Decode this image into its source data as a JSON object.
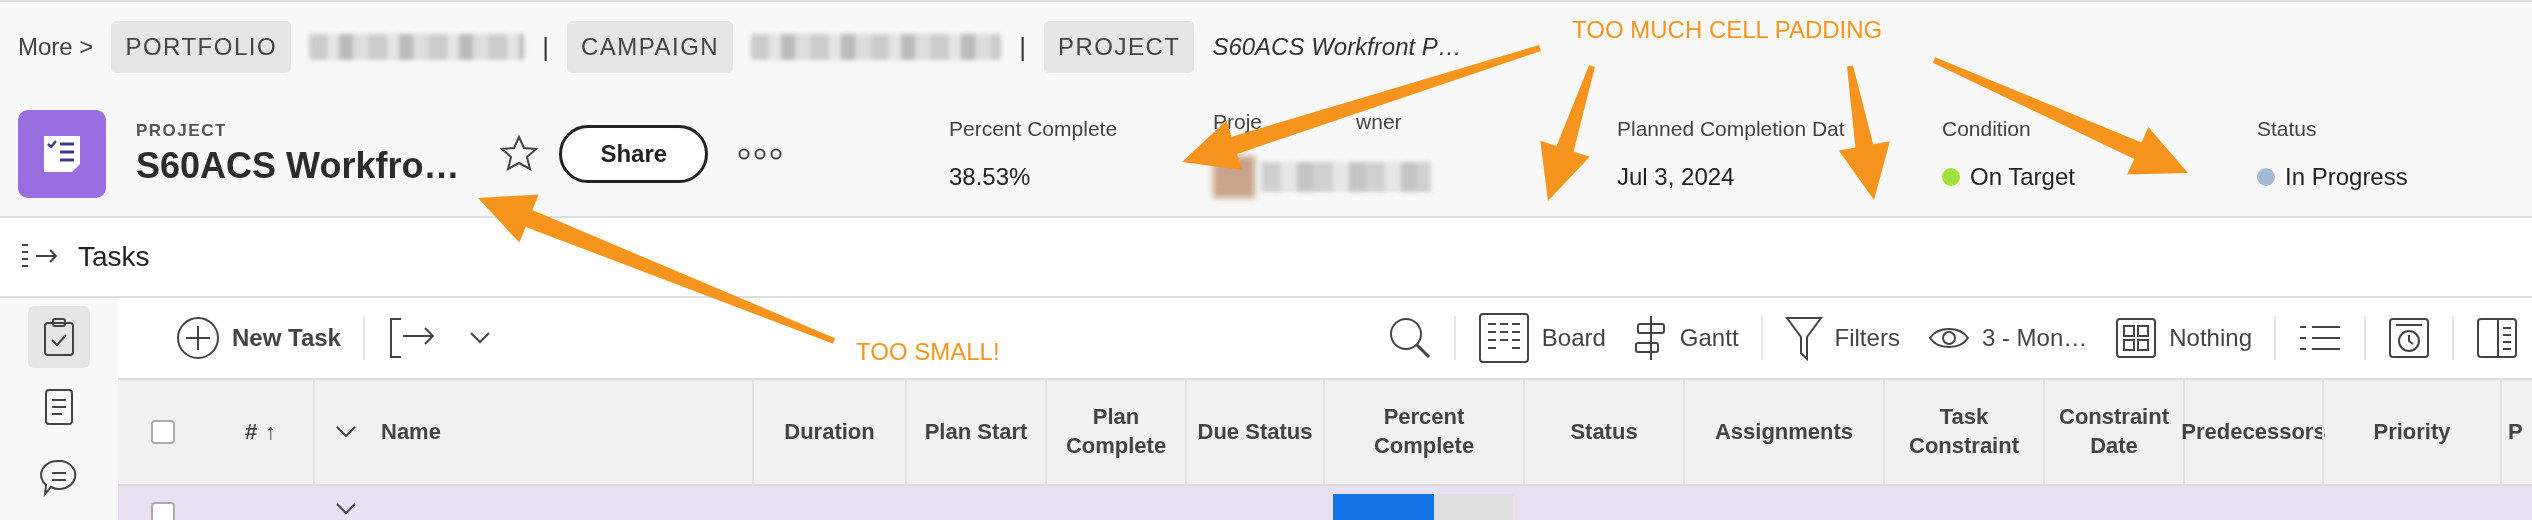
{
  "breadcrumb": {
    "more": "More",
    "separator": ">",
    "crumbs": [
      {
        "label": "PORTFOLIO",
        "name_redacted": true
      },
      {
        "divider": "|",
        "label": "CAMPAIGN",
        "name_redacted": true
      },
      {
        "divider": "|",
        "label": "PROJECT",
        "name": "S60ACS Workfront P…",
        "name_redacted": false
      }
    ]
  },
  "header": {
    "object_type": "PROJECT",
    "title": "S60ACS Workfro…",
    "favorite": false,
    "share_button": "Share",
    "fields": [
      {
        "label": "Percent Complete",
        "value": "38.53%"
      },
      {
        "label_fragments": [
          "Proje",
          "wner"
        ],
        "value_redacted": true
      },
      {
        "label": "Planned Completion Dat",
        "value": "Jul 3, 2024"
      },
      {
        "label": "Condition",
        "value": "On Target",
        "color": "#a2e03c"
      },
      {
        "label": "Status",
        "value": "In Progress",
        "color": "#a4b9d4"
      }
    ]
  },
  "section": {
    "title": "Tasks"
  },
  "rail": [
    {
      "kind": "tasks",
      "selected": true
    },
    {
      "kind": "document",
      "selected": false
    },
    {
      "kind": "comments",
      "selected": false
    }
  ],
  "toolbar": {
    "new_task": "New Task",
    "tools": [
      {
        "kind": "search"
      },
      {
        "kind": "board",
        "label": "Board"
      },
      {
        "kind": "gantt",
        "label": "Gantt"
      },
      {
        "kind": "filter",
        "label": "Filters"
      },
      {
        "kind": "eye",
        "label": "3 - Mon…"
      },
      {
        "kind": "grouping",
        "label": "Nothing"
      },
      {
        "kind": "list"
      },
      {
        "kind": "clock"
      },
      {
        "kind": "panel"
      }
    ]
  },
  "table": {
    "all_checked": false,
    "columns": [
      {
        "kind": "number",
        "label": "#",
        "sort": "↑"
      },
      {
        "kind": "name",
        "label": "Name"
      },
      {
        "label": "Duration"
      },
      {
        "label": "Plan Start"
      },
      {
        "label": "Plan Complete"
      },
      {
        "label": "Due Status"
      },
      {
        "label": "Percent Complete"
      },
      {
        "label": "Status"
      },
      {
        "label": "Assignments"
      },
      {
        "label": "Task Constraint"
      },
      {
        "label": "Constraint Date"
      },
      {
        "label": "Predecessors"
      },
      {
        "label": "Priority"
      },
      {
        "label": "P"
      }
    ],
    "rows": [
      {
        "checked": false,
        "expanded": true,
        "level": 0.5625
      }
    ]
  },
  "annotations": [
    {
      "text": "TOO MUCH CELL PADDING"
    },
    {
      "text": "TOO SMALL!"
    }
  ]
}
